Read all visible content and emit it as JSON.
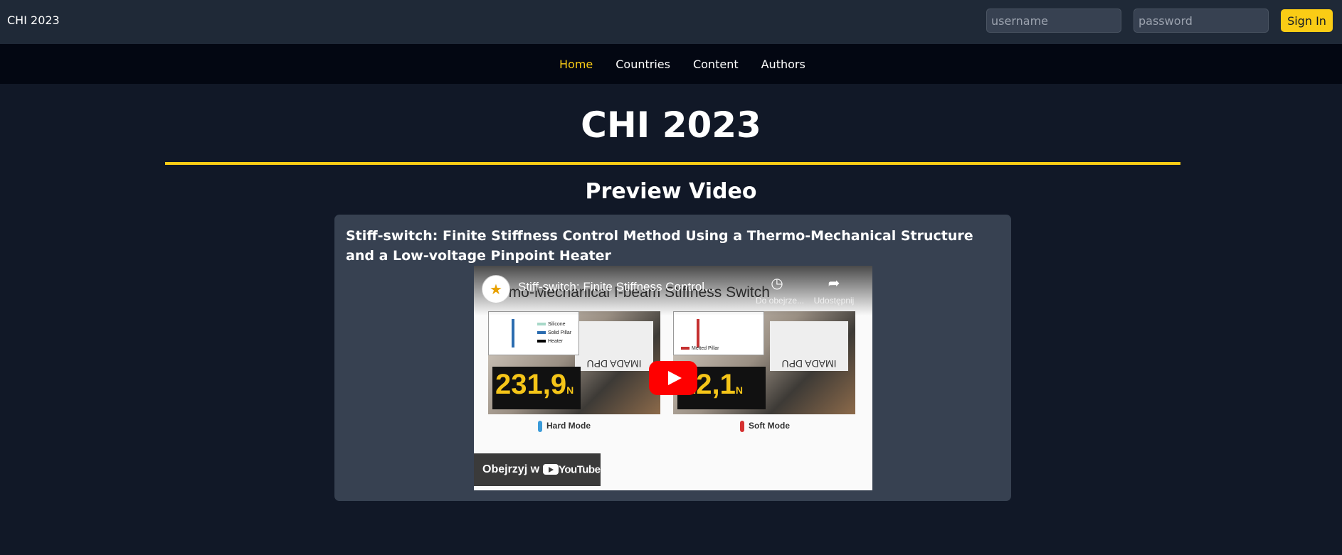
{
  "header": {
    "brand": "CHI 2023",
    "username_placeholder": "username",
    "password_placeholder": "password",
    "signin_label": "Sign In"
  },
  "nav": {
    "items": [
      {
        "label": "Home",
        "active": true
      },
      {
        "label": "Countries",
        "active": false
      },
      {
        "label": "Content",
        "active": false
      },
      {
        "label": "Authors",
        "active": false
      }
    ]
  },
  "main": {
    "title": "CHI 2023",
    "section_title": "Preview Video",
    "video_card": {
      "title": "Stiff-switch: Finite Stiffness Control Method Using a Thermo-Mechanical Structure and a Low-voltage Pinpoint Heater",
      "player": {
        "video_title": "Stiff-switch: Finite Stiffness Control...",
        "subtitle": "ermo-Mechanical I-beam Stiffness Switch",
        "watch_later_label": "Do obejrze...",
        "share_label": "Udostępnij",
        "left_panel": {
          "legend": [
            "Silicone",
            "Solid Pillar",
            "Heater"
          ],
          "readout": "231,9",
          "unit": "N",
          "device_label": "IMADA DPU",
          "mode_label": "Hard Mode"
        },
        "right_panel": {
          "legend": [
            "Melted Pillar"
          ],
          "readout": "12,1",
          "unit": "N",
          "device_label": "IMADA DPU",
          "mode_label": "Soft Mode"
        },
        "watch_on_label": "Obejrzyj w",
        "youtube_wordmark": "YouTube"
      }
    }
  },
  "colors": {
    "accent": "#facc15",
    "topbar": "#1f2937",
    "navbar": "#030712",
    "background": "#111827",
    "card": "#374151"
  }
}
